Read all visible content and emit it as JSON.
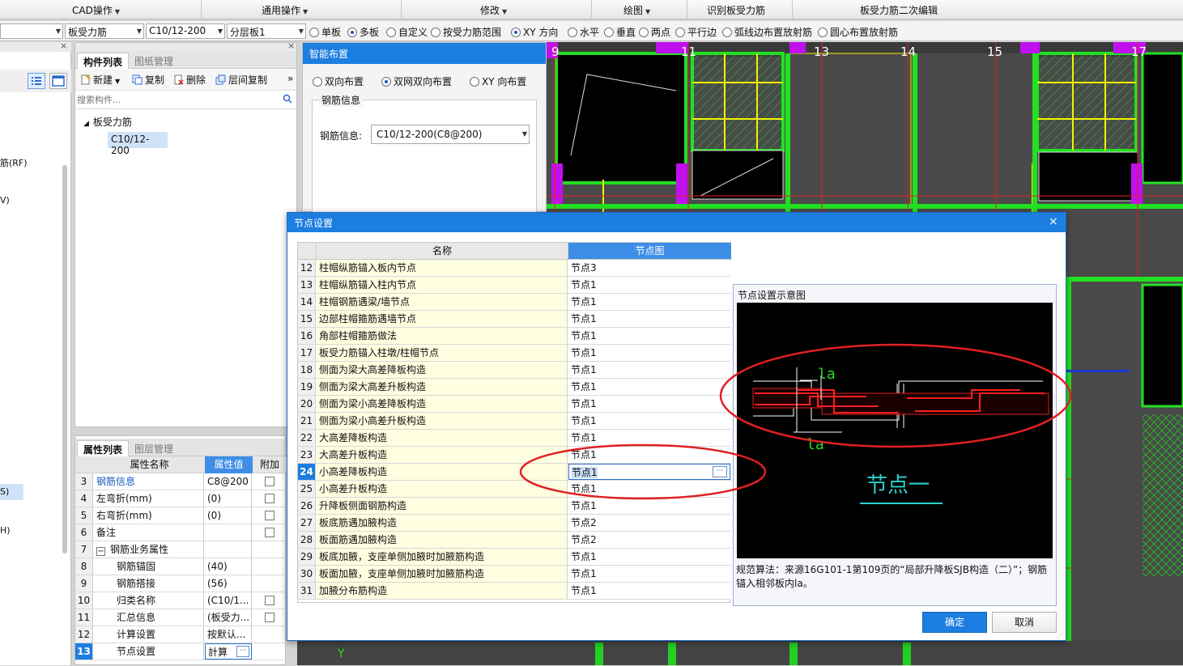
{
  "menu": {
    "cad_ops": "CAD操作",
    "common_ops": "通用操作",
    "modify": "修改",
    "draw": "绘图",
    "recognize": "识别板受力筋",
    "second_edit": "板受力筋二次编辑"
  },
  "toolbar": {
    "combo_type": "板受力筋",
    "combo_rebar": "C10/12-200",
    "combo_layer": "分层板1",
    "radios": [
      "单板",
      "多板",
      "自定义",
      "按受力筋范围",
      "XY 方向",
      "水平",
      "垂直",
      "两点",
      "平行边",
      "弧线边布置放射筋",
      "圆心布置放射筋"
    ],
    "selected_radios": [
      "多板",
      "XY 方向"
    ]
  },
  "left_panel": {
    "items": [
      "筋(RF)",
      "V)",
      "S)",
      "H)"
    ]
  },
  "component_panel": {
    "tab_active": "构件列表",
    "tab_inactive": "图纸管理",
    "new_label": "新建",
    "copy_label": "复制",
    "delete_label": "删除",
    "layer_copy_label": "层间复制",
    "more": "»",
    "search_placeholder": "搜索构件...",
    "tree_root": "板受力筋",
    "tree_child": "C10/12-200"
  },
  "smart_panel": {
    "title": "智能布置",
    "options": [
      "双向布置",
      "双网双向布置",
      "XY 向布置"
    ],
    "selected": "双网双向布置",
    "group_label": "钢筋信息",
    "field_label": "钢筋信息:",
    "field_value": "C10/12-200(C8@200)"
  },
  "props_panel": {
    "tab_active": "属性列表",
    "tab_inactive": "图层管理",
    "headers": [
      "属性名称",
      "属性值",
      "附加"
    ],
    "rows": [
      {
        "n": "3",
        "k": "钢筋信息",
        "v": "C8@200",
        "chk": true,
        "link": true
      },
      {
        "n": "4",
        "k": "左弯折(mm)",
        "v": "(0)",
        "chk": true
      },
      {
        "n": "5",
        "k": "右弯折(mm)",
        "v": "(0)",
        "chk": true
      },
      {
        "n": "6",
        "k": "备注",
        "v": "",
        "chk": true
      },
      {
        "n": "7",
        "k": "钢筋业务属性",
        "v": "",
        "chk": false,
        "group": true
      },
      {
        "n": "8",
        "k": "钢筋锚固",
        "v": "(40)",
        "chk": false,
        "sub": true
      },
      {
        "n": "9",
        "k": "钢筋搭接",
        "v": "(56)",
        "chk": false,
        "sub": true
      },
      {
        "n": "10",
        "k": "归类名称",
        "v": "(C10/1...",
        "chk": true,
        "sub": true
      },
      {
        "n": "11",
        "k": "汇总信息",
        "v": "(板受力...",
        "chk": true,
        "sub": true
      },
      {
        "n": "12",
        "k": "计算设置",
        "v": "按默认...",
        "chk": false,
        "sub": true
      },
      {
        "n": "13",
        "k": "节点设置",
        "v": "計算",
        "chk": false,
        "sub": true,
        "sel": true
      }
    ],
    "group_toggle": "−",
    "ellipsis": "···"
  },
  "dialog": {
    "title": "节点设置",
    "close": "×",
    "col_name": "名称",
    "col_node": "节点图",
    "rows": [
      {
        "n": "12",
        "name": "柱帽纵筋锚入板内节点",
        "node": "节点3"
      },
      {
        "n": "13",
        "name": "柱帽纵筋锚入柱内节点",
        "node": "节点1"
      },
      {
        "n": "14",
        "name": "柱帽钢筋遇梁/墙节点",
        "node": "节点1"
      },
      {
        "n": "15",
        "name": "边部柱帽箍筋遇墙节点",
        "node": "节点1"
      },
      {
        "n": "16",
        "name": "角部柱帽箍筋做法",
        "node": "节点1"
      },
      {
        "n": "17",
        "name": "板受力筋锚入柱墩/柱帽节点",
        "node": "节点1"
      },
      {
        "n": "18",
        "name": "侧面为梁大高差降板构造",
        "node": "节点1"
      },
      {
        "n": "19",
        "name": "侧面为梁大高差升板构造",
        "node": "节点1"
      },
      {
        "n": "20",
        "name": "侧面为梁小高差降板构造",
        "node": "节点1"
      },
      {
        "n": "21",
        "name": "侧面为梁小高差升板构造",
        "node": "节点1"
      },
      {
        "n": "22",
        "name": "大高差降板构造",
        "node": "节点1"
      },
      {
        "n": "23",
        "name": "大高差升板构造",
        "node": "节点1"
      },
      {
        "n": "24",
        "name": "小高差降板构造",
        "node": "节点1",
        "sel": true
      },
      {
        "n": "25",
        "name": "小高差升板构造",
        "node": "节点1"
      },
      {
        "n": "26",
        "name": "升降板侧面钢筋构造",
        "node": "节点1"
      },
      {
        "n": "27",
        "name": "板底筋遇加腋构造",
        "node": "节点2"
      },
      {
        "n": "28",
        "name": "板面筋遇加腋构造",
        "node": "节点2"
      },
      {
        "n": "29",
        "name": "板底加腋，支座单侧加腋时加腋筋构造",
        "node": "节点1"
      },
      {
        "n": "30",
        "name": "板面加腋，支座单侧加腋时加腋筋构造",
        "node": "节点1"
      },
      {
        "n": "31",
        "name": "加腋分布筋构造",
        "node": "节点1"
      }
    ],
    "preview_title": "节点设置示意图",
    "preview_caption": "节点一",
    "la_label": "la",
    "description": "规范算法：来源16G101-1第109页的“局部升降板SJB构造（二）”；钢筋锚入相邻板内la。",
    "ok": "确定",
    "cancel": "取消",
    "ellipsis": "···"
  },
  "cad": {
    "axis_labels": [
      "9",
      "11",
      "13",
      "14",
      "15",
      "17"
    ],
    "y_label": "Y"
  },
  "colors": {
    "accent": "#1c7ee0",
    "highlight_circle": "#e02020",
    "cad_bg": "#4a4a4a",
    "cad_green": "#22e022",
    "cad_yellow": "#f2f200",
    "cad_magenta": "#c010f0"
  }
}
